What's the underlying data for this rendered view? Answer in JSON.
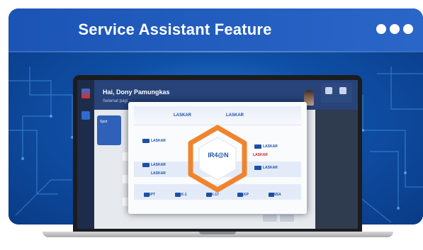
{
  "header": {
    "title": "Service Assistant Feature",
    "menu_icon": "more-dots-icon"
  },
  "app": {
    "greeting": "Hai, Dony Pamungkas",
    "subtitle": "Selamat pagi",
    "panel_label": "Spot"
  },
  "modal": {
    "brand_left": "LASKAR",
    "brand_right": "LASKAR",
    "hub_label": "IR4@N",
    "features": [
      "LASKAR",
      "LASKAR",
      "LASKAR",
      "LASKAR",
      "LASKAR",
      "LASKAR"
    ],
    "bottom_items": [
      "SPT",
      "LK-1",
      "LK-17",
      "LKP",
      "LNSA"
    ]
  },
  "colors": {
    "header_bg": "#1b54b4",
    "card_bg": "#0c3f93",
    "modal_accent": "#1d4fa6",
    "hex_orange": "#f0842e"
  }
}
